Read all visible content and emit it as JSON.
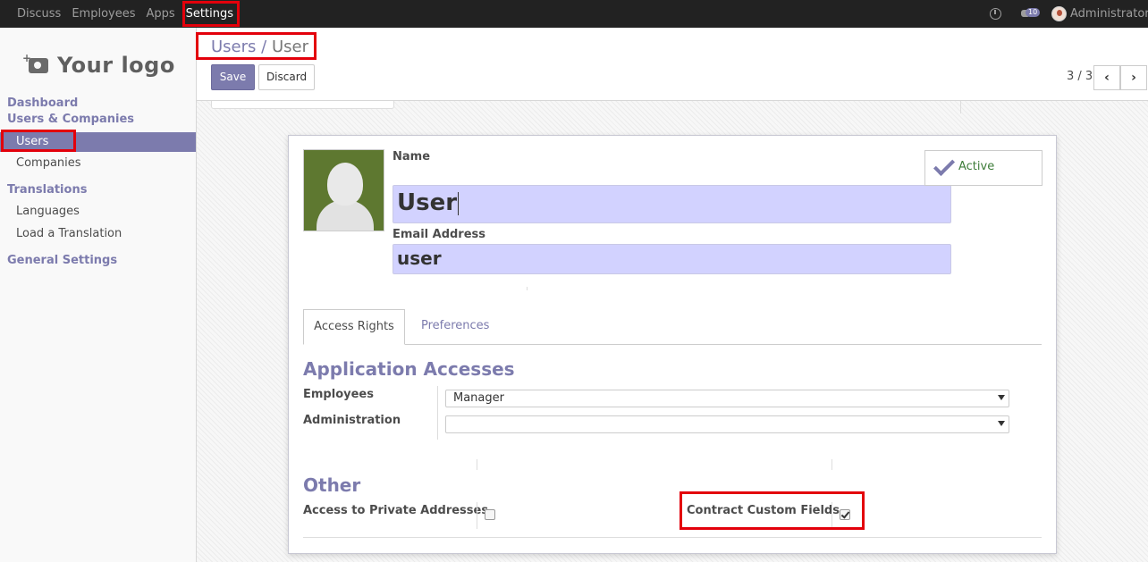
{
  "topbar": {
    "menu": [
      "Discuss",
      "Employees",
      "Apps",
      "Settings"
    ],
    "badge_count": "10",
    "user_name": "Administrator"
  },
  "sidebar": {
    "logo_text": "Your logo",
    "dashboard": "Dashboard",
    "users_companies": "Users & Companies",
    "users": "Users",
    "companies": "Companies",
    "translations": "Translations",
    "languages": "Languages",
    "load_translation": "Load a Translation",
    "general_settings": "General Settings"
  },
  "control": {
    "breadcrumb_parent": "Users",
    "breadcrumb_sep": "/",
    "breadcrumb_current": "User",
    "save_label": "Save",
    "discard_label": "Discard",
    "pager": "3 / 3"
  },
  "form": {
    "name_label": "Name",
    "name_value": "User",
    "email_label": "Email Address",
    "email_value": "user",
    "active_label": "Active",
    "tabs": [
      "Access Rights",
      "Preferences"
    ],
    "app_accesses_title": "Application Accesses",
    "employees_label": "Employees",
    "employees_value": "Manager",
    "administration_label": "Administration",
    "administration_value": "",
    "other_title": "Other",
    "private_addresses_label": "Access to Private Addresses",
    "private_addresses_checked": false,
    "contract_fields_label": "Contract Custom Fields",
    "contract_fields_checked": true
  },
  "colors": {
    "accent": "#7c7bad",
    "topbar": "#222222",
    "highlight": "#e3000b",
    "input_bg": "#d2d2ff"
  }
}
